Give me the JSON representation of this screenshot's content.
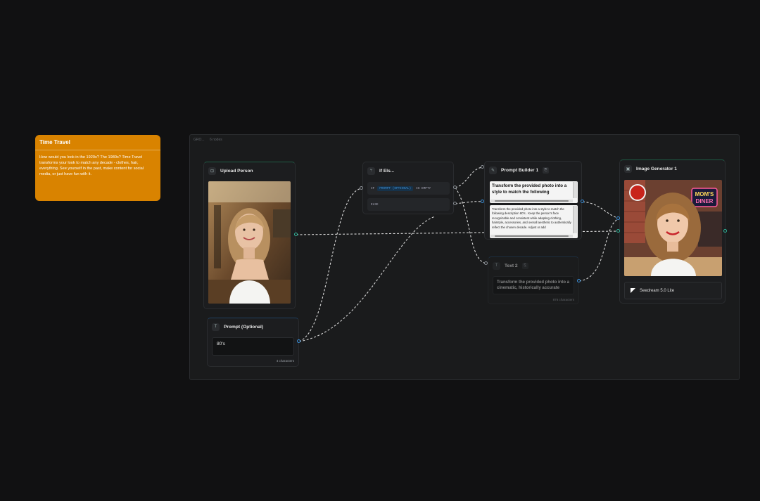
{
  "note": {
    "title": "Time Travel",
    "body": "How would you look in the 1920s? The 1980s? Time Travel transforms your look to match any decade - clothes, hair, everything. See yourself in the past, make content for social media, or just have fun with it."
  },
  "group": {
    "name": "GRO...",
    "count": "6 nodes"
  },
  "nodes": {
    "upload": {
      "title": "Upload Person",
      "icon": "upload-icon"
    },
    "prompt_optional": {
      "title": "Prompt (Optional)",
      "value": "80's",
      "char_count": "4 characters"
    },
    "if_else": {
      "title": "If Els...",
      "if_kw": "IF",
      "if_value": "PROMPT (OPTIONAL)",
      "condition": "IS EMPTY",
      "else_kw": "ELSE"
    },
    "prompt_builder": {
      "title": "Prompt Builder 1",
      "template": "Transform the provided photo into a style to match the following",
      "preview": "Transform the provided photo into a style to match the following description 80's . Keep the person's face recognizable and consistent while adapting clothing, hairstyle, accessories, and overall aesthetic to authentically reflect the chosen decade. Adjust or add"
    },
    "text2": {
      "title": "Text 2",
      "value": "Transform the provided photo into a cinematic, historically accurate",
      "char_count": "876 characters"
    },
    "image_gen": {
      "title": "Image Generator 1",
      "model": "Seedream 5.0 Lite"
    }
  },
  "colors": {
    "note": "#d98300",
    "port_green": "#2fb59a",
    "port_blue": "#3b8fd9",
    "background": "#111112"
  }
}
